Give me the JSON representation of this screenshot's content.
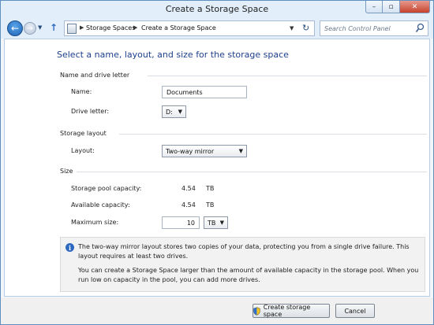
{
  "window": {
    "title": "Create a Storage Space"
  },
  "titlebar": {
    "minimize_glyph": "–",
    "maximize_glyph": "▫",
    "close_glyph": "✕"
  },
  "nav": {
    "back_glyph": "←",
    "forward_glyph": "→",
    "history_glyph": "▼",
    "up_glyph": "↑",
    "breadcrumb": [
      "Storage Spaces",
      "Create a Storage Space"
    ],
    "crumb_sep": "▶",
    "dropdown_glyph": "▼",
    "refresh_glyph": "↻",
    "search_placeholder": "Search Control Panel"
  },
  "page": {
    "title": "Select a name, layout, and size for the storage space",
    "name_section": {
      "heading": "Name and drive letter",
      "name_label": "Name:",
      "name_value": "Documents",
      "drive_label": "Drive letter:",
      "drive_value": "D:"
    },
    "layout_section": {
      "heading": "Storage layout",
      "layout_label": "Layout:",
      "layout_value": "Two-way mirror"
    },
    "size_section": {
      "heading": "Size",
      "pool_label": "Storage pool capacity:",
      "pool_value": "4.54",
      "pool_unit": "TB",
      "avail_label": "Available capacity:",
      "avail_value": "4.54",
      "avail_unit": "TB",
      "max_label": "Maximum size:",
      "max_value": "10",
      "max_unit": "TB"
    },
    "info": {
      "icon_glyph": "i",
      "p1": "The two-way mirror layout stores two copies of your data, protecting you from a single drive failure. This layout requires at least two drives.",
      "p2": "You can create a Storage Space larger than the amount of available capacity in the storage pool. When you run low on capacity in the pool, you can add more drives."
    }
  },
  "footer": {
    "create_label": "Create storage space",
    "cancel_label": "Cancel"
  },
  "colors": {
    "title_blue": "#1e3f8c",
    "chrome": "#e2eefa",
    "close_red": "#c7412c"
  }
}
